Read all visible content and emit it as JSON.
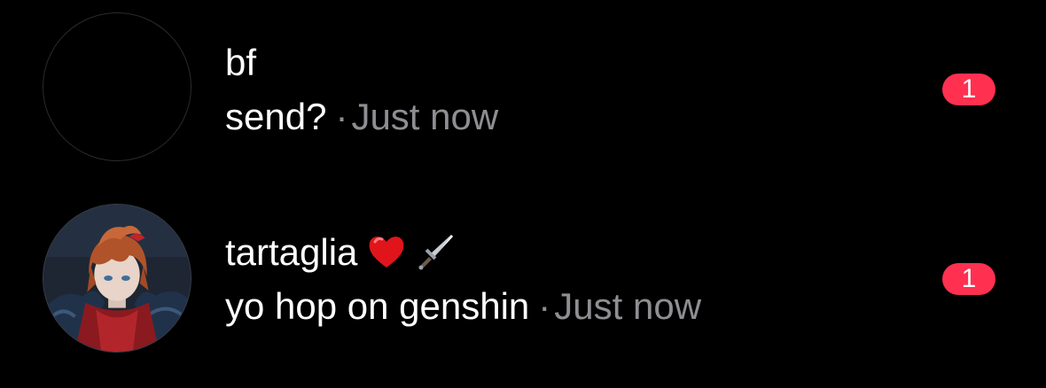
{
  "threads": [
    {
      "name": "bf",
      "preview": "send?",
      "separator": "·",
      "time": "Just now",
      "unread_count": "1",
      "avatar": "empty-avatar",
      "name_emojis": []
    },
    {
      "name": "tartaglia",
      "preview": "yo hop on genshin",
      "separator": "·",
      "time": "Just now",
      "unread_count": "1",
      "avatar": "anime-character-avatar",
      "name_emojis": [
        "heart-emoji",
        "dagger-emoji"
      ]
    }
  ],
  "colors": {
    "background": "#000000",
    "primary_text": "#ffffff",
    "secondary_text": "#8e8e93",
    "badge": "#ff3050"
  }
}
